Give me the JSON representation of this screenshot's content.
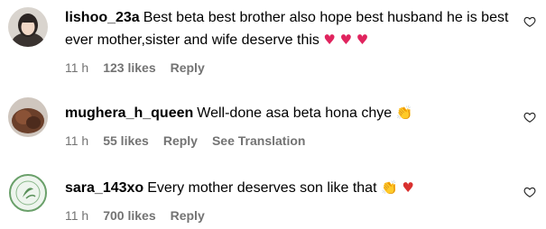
{
  "comments": [
    {
      "username": "lishoo_23a",
      "text": "Best beta best brother also hope best husband he is best ever mother,sister and wife deserve this",
      "emoji": "♥ ♥ ♥",
      "time": "11 h",
      "likes": "123 likes",
      "reply": "Reply",
      "avatar_icon": "woman-portrait-icon"
    },
    {
      "username": "mughera_h_queen",
      "text": "Well-done asa beta hona chye",
      "emoji": "👏",
      "time": "11 h",
      "likes": "55 likes",
      "reply": "Reply",
      "translation": "See Translation",
      "avatar_icon": "brown-photo-icon"
    },
    {
      "username": "sara_143xo",
      "text": "Every mother deserves son like that",
      "emoji": "👏 ♥",
      "time": "11 h",
      "likes": "700 likes",
      "reply": "Reply",
      "avatar_icon": "green-seal-logo-icon"
    }
  ],
  "like_icon": "heart-outline-icon",
  "colors": {
    "meta": "#737373",
    "heart": "#e0245e"
  }
}
